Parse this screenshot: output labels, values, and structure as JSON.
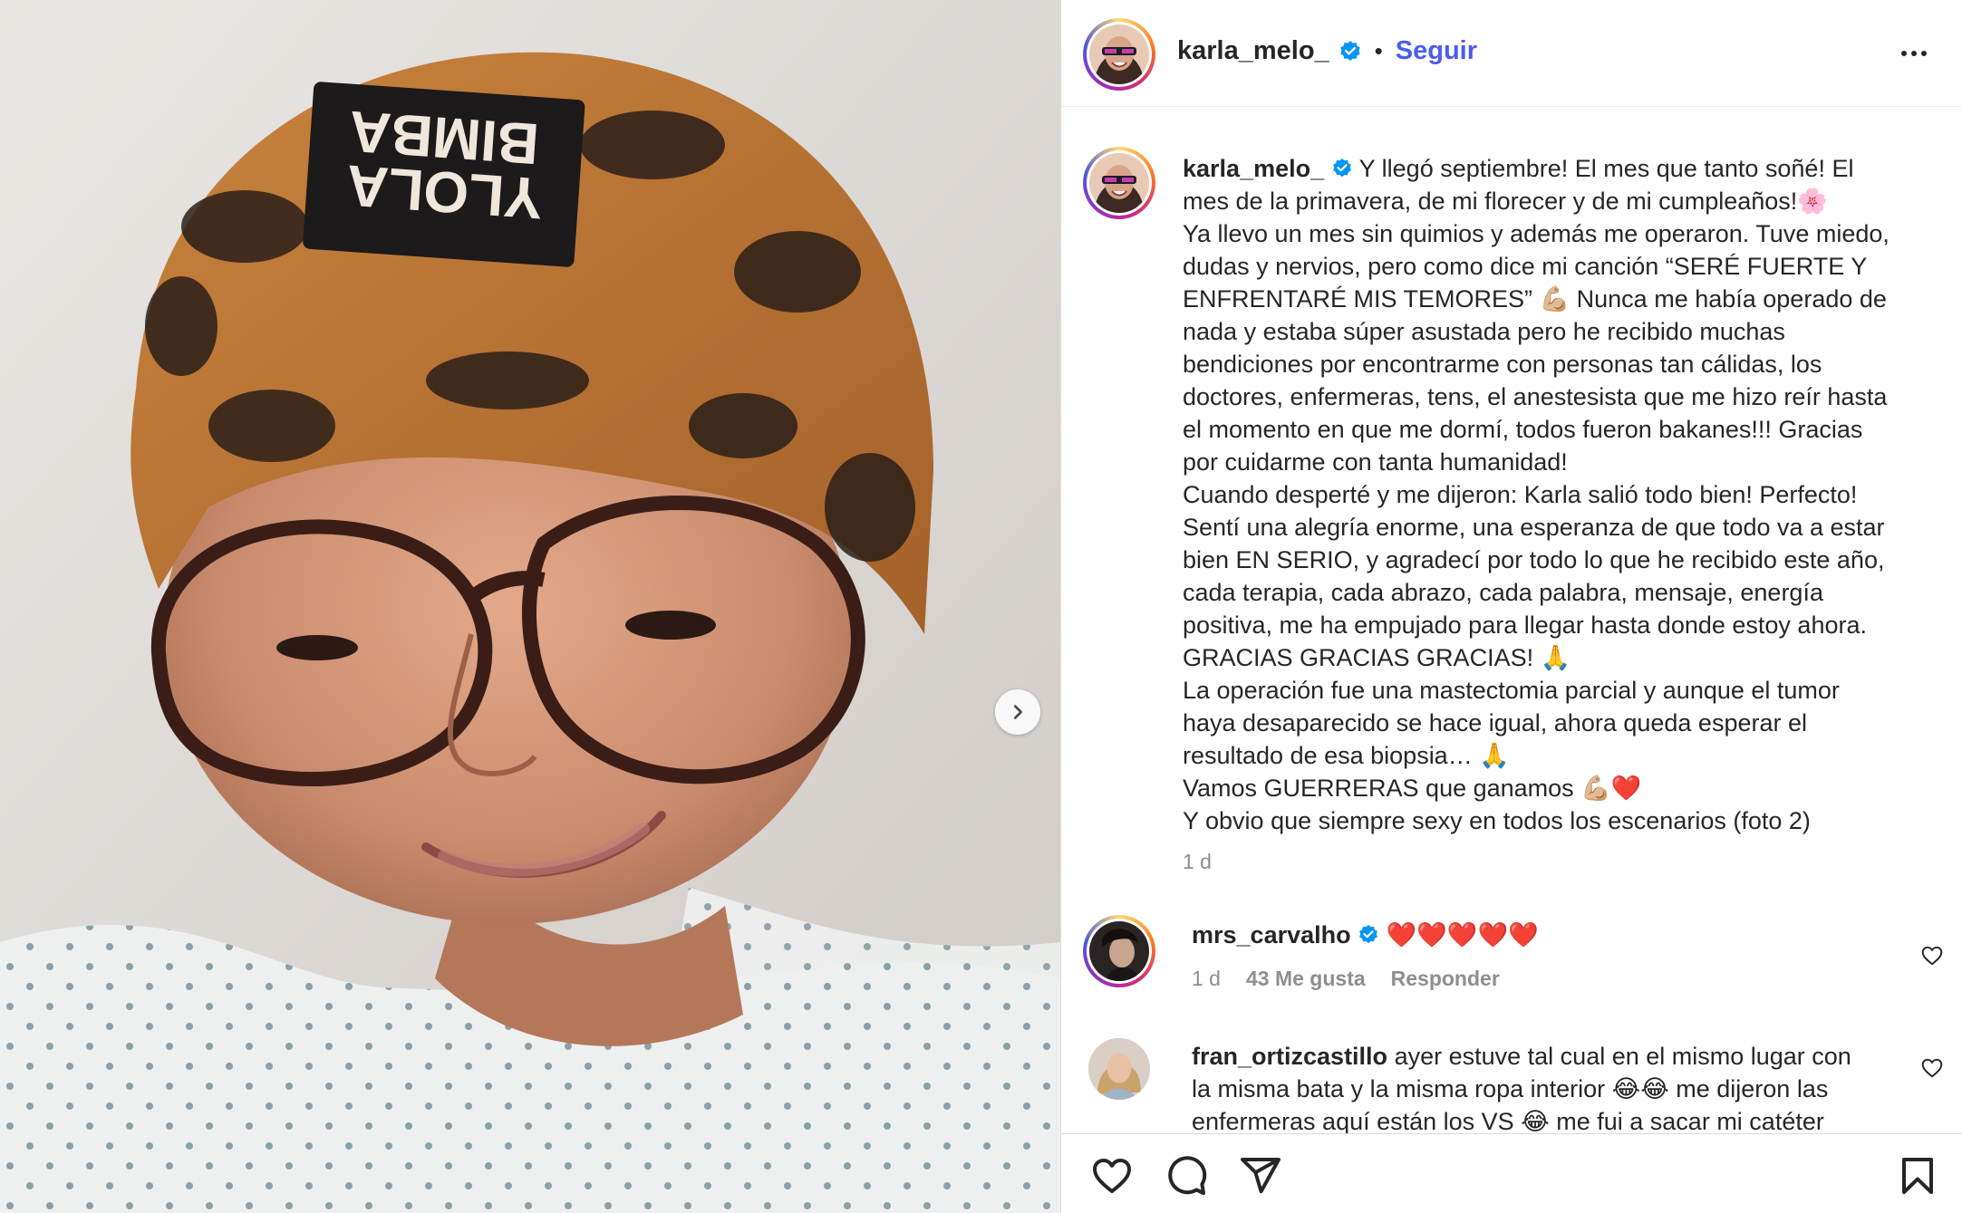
{
  "post": {
    "username": "karla_melo_",
    "follow_label": "Seguir",
    "dot": "•",
    "hat_text_line1": "BIMBA",
    "hat_text_line2": "YLOLA",
    "caption_lines": [
      "Y llegó septiembre! El mes que tanto soñé! El",
      "mes de la primavera, de mi florecer y de mi cumpleaños!🌸",
      "Ya llevo un mes sin quimios y además me operaron. Tuve miedo,",
      "dudas y nervios, pero como dice mi canción “SERÉ FUERTE Y",
      "ENFRENTARÉ MIS TEMORES” 💪🏼 Nunca me había operado de",
      "nada y estaba súper asustada pero he recibido muchas",
      "bendiciones por encontrarme con personas tan cálidas, los",
      "doctores, enfermeras, tens, el anestesista que me hizo reír hasta",
      "el momento en que me dormí, todos fueron bakanes!!! Gracias",
      "por cuidarme con tanta humanidad!",
      "Cuando desperté y me dijeron: Karla salió todo bien! Perfecto!",
      "Sentí una alegría enorme, una esperanza de que todo va a estar",
      "bien EN SERIO, y agradecí por todo lo que he recibido este año,",
      "cada terapia, cada abrazo, cada palabra, mensaje, energía",
      "positiva, me ha empujado para llegar hasta donde estoy ahora.",
      "GRACIAS GRACIAS GRACIAS! 🙏",
      "La operación fue una mastectomia parcial y aunque el tumor",
      "haya desaparecido se hace igual, ahora queda esperar el",
      "resultado de esa biopsia… 🙏",
      "Vamos GUERRERAS que ganamos 💪🏼❤️",
      "Y obvio que siempre sexy en todos los escenarios (foto 2)"
    ],
    "time": "1 d"
  },
  "comments": [
    {
      "username": "mrs_carvalho",
      "verified": true,
      "text": "❤️❤️❤️❤️❤️",
      "time": "1 d",
      "likes": "43 Me gusta",
      "reply": "Responder"
    },
    {
      "username": "fran_ortizcastillo",
      "verified": false,
      "line1": "ayer estuve tal cual en el mismo lugar con",
      "line2": "la misma bata y la misma ropa interior 😂😂 me dijeron las",
      "line3": "enfermeras aquí están los VS 😂 me fui a sacar mi catéter"
    }
  ],
  "colors": {
    "follow": "#4a5cf5",
    "verified": "#0095f6",
    "muted": "#8e8e8e"
  }
}
